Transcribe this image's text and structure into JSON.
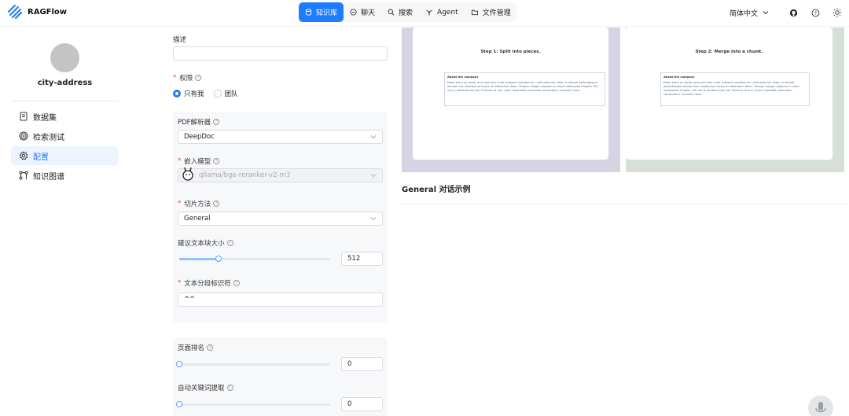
{
  "app": {
    "name": "RAGFlow"
  },
  "nav": [
    {
      "label": "知识库",
      "icon": "database-icon",
      "active": true
    },
    {
      "label": "聊天",
      "icon": "chat-icon",
      "active": false
    },
    {
      "label": "搜索",
      "icon": "search-icon",
      "active": false
    },
    {
      "label": "Agent",
      "icon": "agent-icon",
      "active": false
    },
    {
      "label": "文件管理",
      "icon": "folder-icon",
      "active": false
    }
  ],
  "header_right": {
    "language": "简体中文"
  },
  "sidebar": {
    "kb_name": "city-address",
    "items": [
      {
        "label": "数据集",
        "icon": "dataset-icon",
        "active": false
      },
      {
        "label": "检索测试",
        "icon": "retrieval-test-icon",
        "active": false
      },
      {
        "label": "配置",
        "icon": "gear-icon",
        "active": true
      },
      {
        "label": "知识图谱",
        "icon": "knowledge-graph-icon",
        "active": false
      }
    ]
  },
  "form": {
    "description_label": "描述",
    "description_value": "",
    "permission_label": "权限",
    "permission_options": [
      "只有我",
      "团队"
    ],
    "pdf_parser_label": "PDF解析器",
    "pdf_parser_value": "DeepDoc",
    "embedding_label": "嵌入模型",
    "embedding_value": "qllama/bge-reranker-v2-m3",
    "chunk_method_label": "切片方法",
    "chunk_method_value": "General",
    "chunk_size_label": "建议文本块大小",
    "chunk_size_value": "512",
    "chunk_size_fraction": 0.26,
    "delimiter_label": "文本分段标识符",
    "delimiter_value": "^^",
    "page_rank_label": "页面排名",
    "page_rank_value": "0",
    "auto_keywords_label": "自动关键词提取",
    "auto_keywords_value": "0"
  },
  "preview": {
    "step1": "Step 1: Split into pieces.",
    "step2": "Step 2: Merge into a chunk.",
    "company_title": "About the company",
    "company_text": "Dolor enim eu tortor urna sed duis nulla. Aliquam vestibulum, nulla odio nisl vitae. In aliquet pellentesque aenean hac vestibulum turpis mi bibendum diam. Tempor integer aliquam in vitae malesuada fringilla. Elit nisi in eleifend sed nisi. Pulvinar at orci, proin imperdiet commodo consectetur convallis risus.",
    "section_title": "General 对话示例"
  },
  "colors": {
    "accent": "#1f7cff",
    "preview_left_bg": "#d7d3e3",
    "preview_right_bg": "#d6e0d8"
  }
}
